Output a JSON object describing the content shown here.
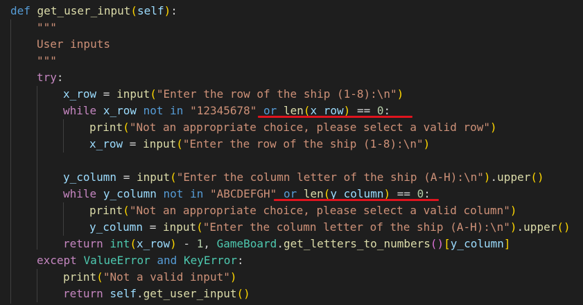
{
  "code": {
    "l1": {
      "def": "def",
      "name": "get_user_input",
      "open": "(",
      "self": "self",
      "close": ")",
      "colon": ":"
    },
    "l2": {
      "doc": "\"\"\""
    },
    "l3": {
      "doc": "User inputs"
    },
    "l4": {
      "doc": "\"\"\""
    },
    "l5": {
      "try": "try",
      "colon": ":"
    },
    "l6": {
      "var": "x_row",
      "eq": " = ",
      "fn": "input",
      "open": "(",
      "str": "\"Enter the row of the ship (1-8):\\n\"",
      "close": ")"
    },
    "l7": {
      "while": "while",
      "var": "x_row",
      "not": "not",
      "in": "in",
      "str": "\"12345678\"",
      "or": "or",
      "len": "len",
      "open": "(",
      "arg": "x_row",
      "close": ")",
      "eqeq": " == ",
      "num": "0",
      "colon": ":"
    },
    "l8": {
      "fn": "print",
      "open": "(",
      "str": "\"Not an appropriate choice, please select a valid row\"",
      "close": ")"
    },
    "l9": {
      "var": "x_row",
      "eq": " = ",
      "fn": "input",
      "open": "(",
      "str": "\"Enter the row of the ship (1-8):\\n\"",
      "close": ")"
    },
    "l11": {
      "var": "y_column",
      "eq": " = ",
      "fn": "input",
      "open": "(",
      "str": "\"Enter the column letter of the ship (A-H):\\n\"",
      "close": ")",
      "dot": ".",
      "upper": "upper",
      "uopen": "(",
      "uclose": ")"
    },
    "l12": {
      "while": "while",
      "var": "y_column",
      "not": "not",
      "in": "in",
      "str": "\"ABCDEFGH\"",
      "or": "or",
      "len": "len",
      "open": "(",
      "arg": "y_column",
      "close": ")",
      "eqeq": " == ",
      "num": "0",
      "colon": ":"
    },
    "l13": {
      "fn": "print",
      "open": "(",
      "str": "\"Not an appropriate choice, please select a valid column\"",
      "close": ")"
    },
    "l14": {
      "var": "y_column",
      "eq": " = ",
      "fn": "input",
      "open": "(",
      "str": "\"Enter the column letter of the ship (A-H):\\n\"",
      "close": ")",
      "dot": ".",
      "upper": "upper",
      "uopen": "(",
      "uclose": ")"
    },
    "l15": {
      "ret": "return",
      "int": "int",
      "open": "(",
      "arg": "x_row",
      "close": ")",
      "minus": " - ",
      "one": "1",
      "comma": ", ",
      "cls": "GameBoard",
      "dot": ".",
      "fn": "get_letters_to_numbers",
      "fopen": "(",
      "fclose": ")",
      "bopen": "[",
      "key": "y_column",
      "bclose": "]"
    },
    "l16": {
      "except": "except",
      "e1": "ValueError",
      "and": "and",
      "e2": "KeyError",
      "colon": ":"
    },
    "l17": {
      "fn": "print",
      "open": "(",
      "str": "\"Not a valid input\"",
      "close": ")"
    },
    "l18": {
      "ret": "return",
      "self": "self",
      "dot": ".",
      "fn": "get_user_input",
      "open": "(",
      "close": ")"
    }
  },
  "colors": {
    "background": "#1e1e1e",
    "underline": "#e0141e"
  }
}
